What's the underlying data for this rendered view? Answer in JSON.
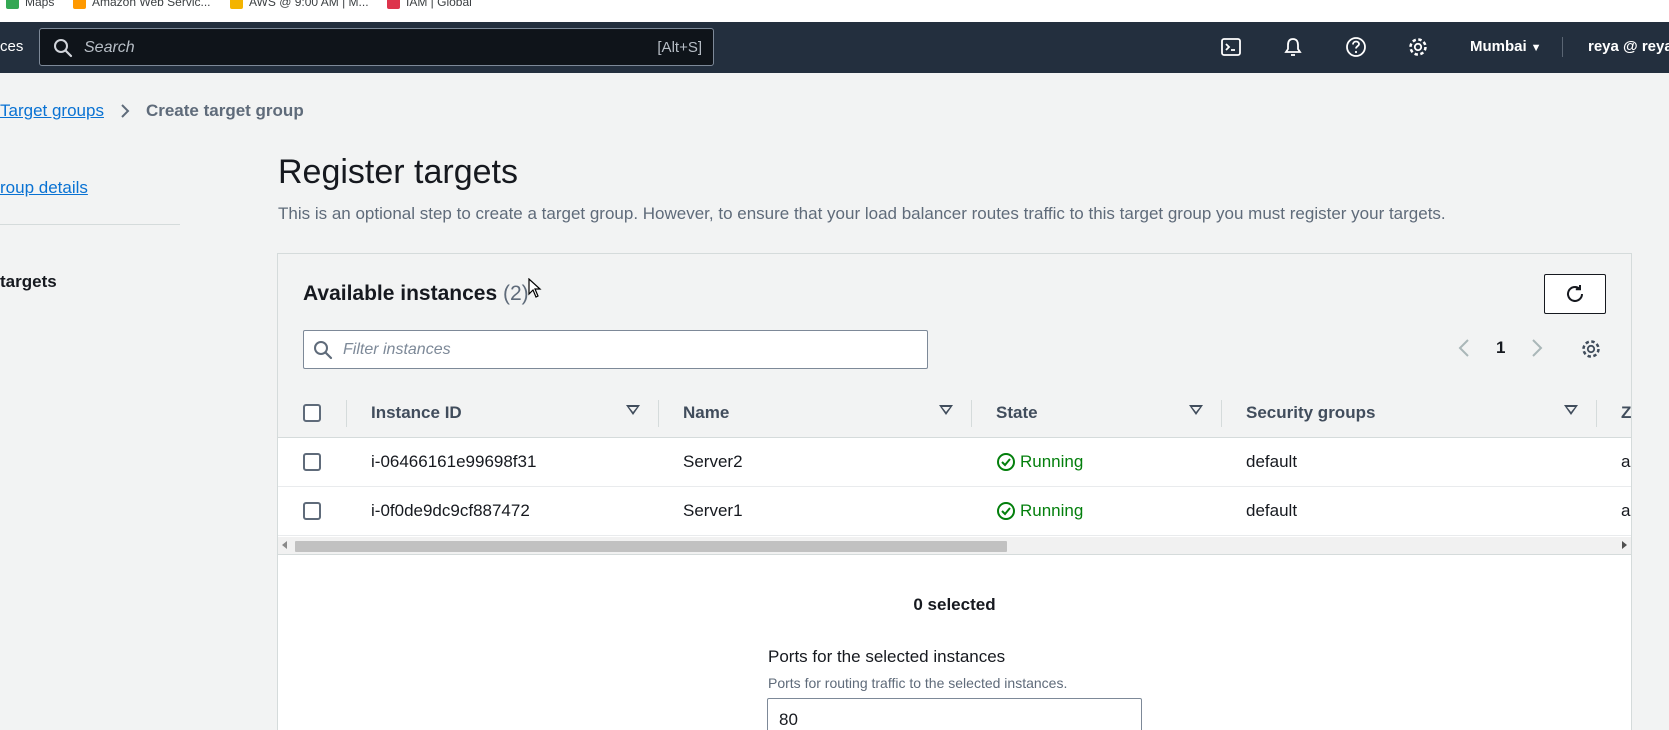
{
  "bookmarks": [
    {
      "label": "Maps",
      "color": "#34a853"
    },
    {
      "label": "Amazon Web Servic...",
      "color": "#ff9900"
    },
    {
      "label": "AWS @ 9:00 AM | M...",
      "color": "#f4b400"
    },
    {
      "label": "IAM | Global",
      "color": "#dd344c"
    }
  ],
  "nav": {
    "left_text": "ces",
    "search_placeholder": "Search",
    "search_shortcut": "[Alt+S]",
    "icons": [
      "cloudshell-icon",
      "bell-icon",
      "help-icon",
      "settings-icon"
    ],
    "region": "Mumbai",
    "user": "reya @ reya"
  },
  "breadcrumb": {
    "parent": "Target groups",
    "current": "Create target group"
  },
  "steps": {
    "step1": "roup details",
    "step2": "targets"
  },
  "page": {
    "title": "Register targets",
    "description": "This is an optional step to create a target group. However, to ensure that your load balancer routes traffic to this target group you must register your targets."
  },
  "instances": {
    "title": "Available instances",
    "count": "(2)",
    "filter_placeholder": "Filter instances",
    "page_number": "1",
    "columns": [
      "Instance ID",
      "Name",
      "State",
      "Security groups",
      "Z"
    ],
    "rows": [
      {
        "instance_id": "i-06466161e99698f31",
        "name": "Server2",
        "state": "Running",
        "security_groups": "default",
        "zone": "a"
      },
      {
        "instance_id": "i-0f0de9dc9cf887472",
        "name": "Server1",
        "state": "Running",
        "security_groups": "default",
        "zone": "a"
      }
    ],
    "selected_text": "0 selected"
  },
  "ports": {
    "label": "Ports for the selected instances",
    "description": "Ports for routing traffic to the selected instances.",
    "value": "80"
  },
  "colors": {
    "nav_bg": "#232f3e",
    "link": "#0972d3",
    "running": "#037f0c"
  }
}
